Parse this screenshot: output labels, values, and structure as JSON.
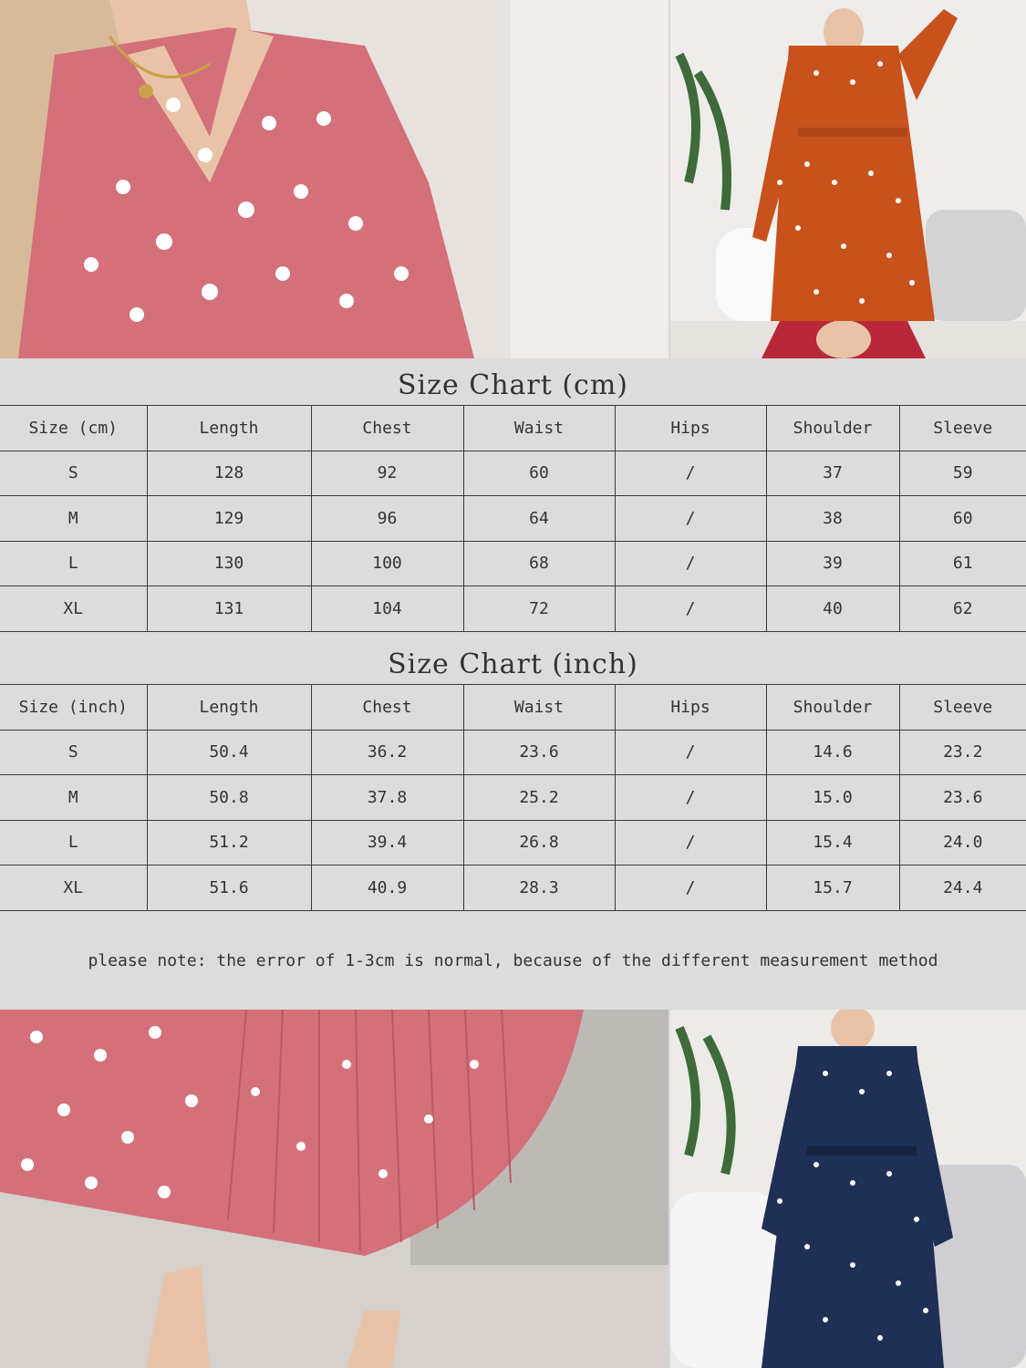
{
  "colors": {
    "panel_background": "#dcdcdc",
    "grid_lines": "#3a3a3a",
    "text": "#333333",
    "dress_pink": "#d4707a",
    "dress_orange": "#c8521c",
    "dress_navy": "#1f2f55",
    "polka_dot": "#ffffff"
  },
  "chart_data": [
    {
      "type": "table",
      "title": "Size Chart (cm)",
      "columns": [
        "Size (cm)",
        "Length",
        "Chest",
        "Waist",
        "Hips",
        "Shoulder",
        "Sleeve"
      ],
      "rows": [
        [
          "S",
          "128",
          "92",
          "60",
          "/",
          "37",
          "59"
        ],
        [
          "M",
          "129",
          "96",
          "64",
          "/",
          "38",
          "60"
        ],
        [
          "L",
          "130",
          "100",
          "68",
          "/",
          "39",
          "61"
        ],
        [
          "XL",
          "131",
          "104",
          "72",
          "/",
          "40",
          "62"
        ]
      ]
    },
    {
      "type": "table",
      "title": "Size Chart (inch)",
      "columns": [
        "Size (inch)",
        "Length",
        "Chest",
        "Waist",
        "Hips",
        "Shoulder",
        "Sleeve"
      ],
      "rows": [
        [
          "S",
          "50.4",
          "36.2",
          "23.6",
          "/",
          "14.6",
          "23.2"
        ],
        [
          "M",
          "50.8",
          "37.8",
          "25.2",
          "/",
          "15.0",
          "23.6"
        ],
        [
          "L",
          "51.2",
          "39.4",
          "26.8",
          "/",
          "15.4",
          "24.0"
        ],
        [
          "XL",
          "51.6",
          "40.9",
          "28.3",
          "/",
          "15.7",
          "24.4"
        ]
      ]
    }
  ],
  "note": "please note: the error of 1-3cm is normal, because of the different measurement method"
}
